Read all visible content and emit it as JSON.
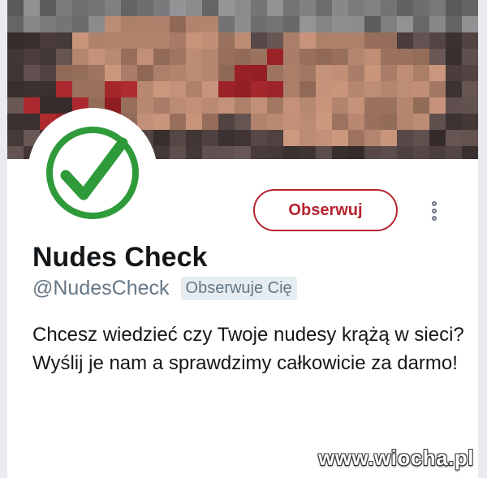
{
  "profile": {
    "display_name": "Nudes Check",
    "handle": "@NudesCheck",
    "follows_you_badge": "Obserwuje Cię",
    "follow_button_label": "Obserwuj",
    "bio": "Chcesz wiedzieć czy Twoje nudesy krążą w sieci? Wyślij je nam a sprawdzimy całkowicie za darmo!",
    "avatar_icon": "green-checkmark-icon",
    "more_icon": "vertical-dots-icon"
  },
  "banner": {
    "description_icon": "pixelated-banner-image"
  },
  "watermark": {
    "text": "www.wiocha.pl"
  },
  "colors": {
    "follow_button_accent": "#b4232f",
    "checkmark_green": "#2e9a3a",
    "handle_gray": "#657786",
    "badge_background": "#e6ecf0",
    "text_dark": "#14171a"
  }
}
